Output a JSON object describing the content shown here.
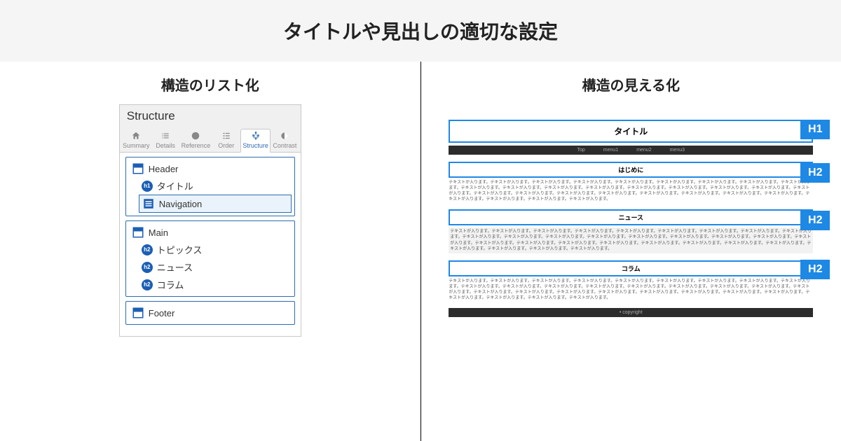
{
  "main_title": "タイトルや見出しの適切な設定",
  "left": {
    "heading": "構造のリスト化",
    "panel_title": "Structure",
    "tabs": {
      "summary": "Summary",
      "details": "Details",
      "reference": "Reference",
      "order": "Order",
      "structure": "Structure",
      "contrast": "Contrast"
    },
    "tree": {
      "header": "Header",
      "title_item": "タイトル",
      "h1_badge": "h1",
      "navigation": "Navigation",
      "main": "Main",
      "topics": "トピックス",
      "news": "ニュース",
      "column": "コラム",
      "h2_badge": "h2",
      "footer": "Footer"
    }
  },
  "right": {
    "heading": "構造の見える化",
    "preview": {
      "title": "タイトル",
      "nav": {
        "top": "Top",
        "m1": "menu1",
        "m2": "menu2",
        "m3": "menu3"
      },
      "sec1": "はじめに",
      "sec2": "ニュース",
      "sec3": "コラム",
      "footer": "• copyright",
      "filler": "テキストが入ります。テキストが入ります。テキストが入ります。テキストが入ります。テキストが入ります。テキストが入ります。テキストが入ります。テキストが入ります。テキストが入ります。テキストが入ります。テキストが入ります。テキストが入ります。テキストが入ります。テキストが入ります。テキストが入ります。テキストが入ります。テキストが入ります。テキストが入ります。テキストが入ります。テキストが入ります。テキストが入ります。テキストが入ります。テキストが入ります。テキストが入ります。テキストが入ります。テキストが入ります。テキストが入ります。テキストが入ります。テキストが入ります。テキストが入ります。"
    },
    "tags": {
      "h1": "H1",
      "h2a": "H2",
      "h2b": "H2",
      "h2c": "H2"
    }
  }
}
